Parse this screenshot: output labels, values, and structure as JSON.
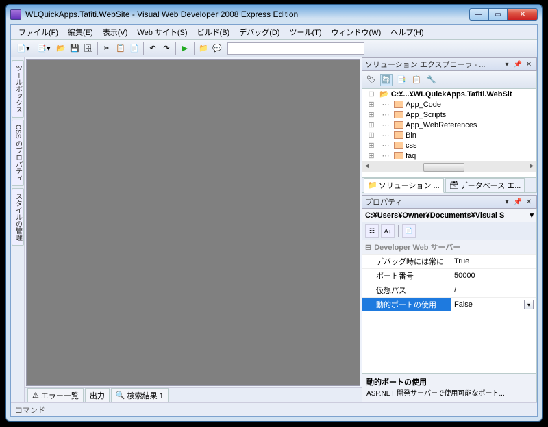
{
  "window": {
    "title": "WLQuickApps.Tafiti.WebSite - Visual Web Developer 2008 Express Edition"
  },
  "menubar": [
    "ファイル(F)",
    "編集(E)",
    "表示(V)",
    "Web サイト(S)",
    "ビルド(B)",
    "デバッグ(D)",
    "ツール(T)",
    "ウィンドウ(W)",
    "ヘルプ(H)"
  ],
  "left_tabs": [
    "ツールボックス",
    "CSS のプロパティ",
    "スタイルの管理"
  ],
  "bottom_tabs": [
    "エラー一覧",
    "出力",
    "検索結果 1"
  ],
  "solution": {
    "title": "ソリューション エクスプローラ - ...",
    "root": "C:¥...¥WLQuickApps.Tafiti.WebSit",
    "nodes": [
      "App_Code",
      "App_Scripts",
      "App_WebReferences",
      "Bin",
      "css",
      "faq"
    ],
    "tabs": [
      "ソリューション ...",
      "データベース エ..."
    ]
  },
  "properties": {
    "title": "プロパティ",
    "target": "C:¥Users¥Owner¥Documents¥Visual S",
    "category": "Developer Web サーバー",
    "rows": [
      {
        "name": "デバッグ時には常に",
        "value": "True"
      },
      {
        "name": "ポート番号",
        "value": "50000"
      },
      {
        "name": "仮想パス",
        "value": "/"
      },
      {
        "name": "動的ポートの使用",
        "value": "False"
      }
    ],
    "description": {
      "title": "動的ポートの使用",
      "text": "ASP.NET 開発サーバーで使用可能なポート..."
    }
  },
  "status": "コマンド"
}
